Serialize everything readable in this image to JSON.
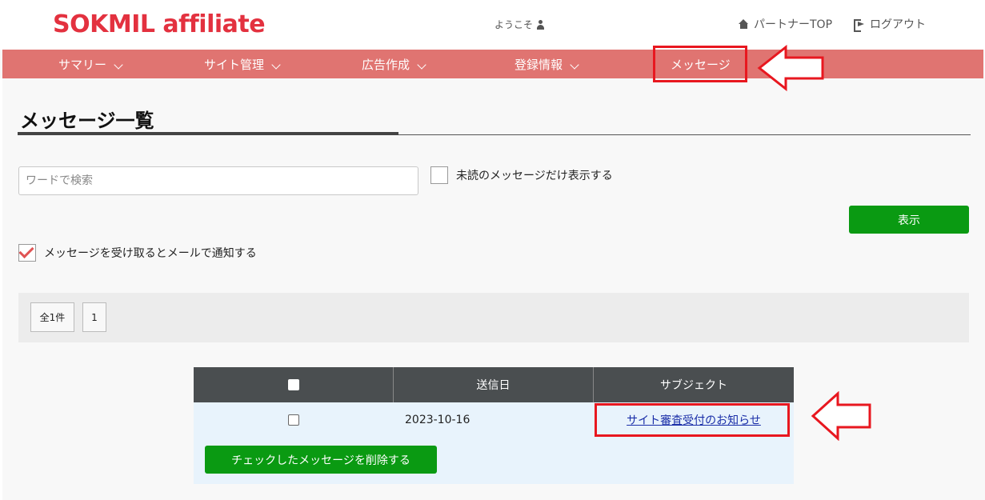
{
  "header": {
    "logo": "SOKMIL affiliate",
    "welcome": "ようこそ",
    "partner_top": "パートナーTOP",
    "logout": "ログアウト"
  },
  "nav": {
    "items": [
      {
        "label": "サマリー",
        "icon": "chevron-down-icon"
      },
      {
        "label": "サイト管理",
        "icon": "chevron-down-icon"
      },
      {
        "label": "広告作成",
        "icon": "chevron-down-icon"
      },
      {
        "label": "登録情報",
        "icon": "chevron-down-icon"
      },
      {
        "label": "メッセージ"
      }
    ]
  },
  "page": {
    "title": "メッセージ一覧"
  },
  "filters": {
    "search_placeholder": "ワードで検索",
    "search_value": "",
    "unread_only_label": "未読のメッセージだけ表示する",
    "unread_only_checked": false,
    "show_button": "表示",
    "email_notify_label": "メッセージを受け取るとメールで通知する",
    "email_notify_checked": true
  },
  "pager": {
    "total": "全1件",
    "page": "1"
  },
  "table": {
    "headers": [
      "",
      "送信日",
      "サブジェクト"
    ],
    "rows": [
      {
        "date": "2023-10-16",
        "subject": "サイト審査受付のお知らせ",
        "checked": false
      }
    ],
    "delete_button": "チェックしたメッセージを削除する"
  },
  "colors": {
    "brand_red": "#e3313f",
    "nav_bg": "#e07471",
    "button_green": "#0a9a12",
    "table_header": "#4a4e50",
    "row_bg": "#e8f3fc",
    "highlight_red": "#e8171f"
  }
}
